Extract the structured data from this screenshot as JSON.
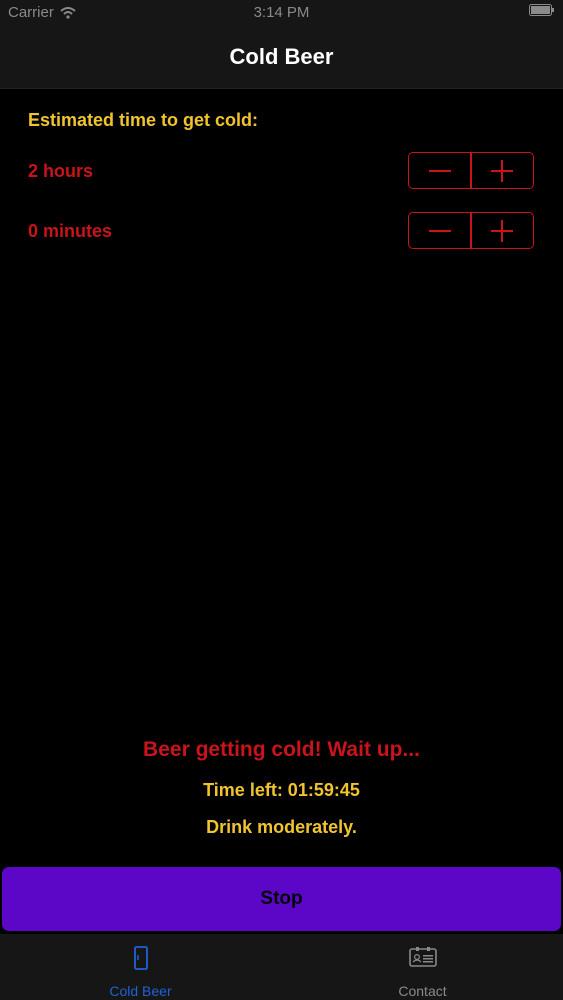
{
  "statusbar": {
    "carrier": "Carrier",
    "time": "3:14 PM"
  },
  "navbar": {
    "title": "Cold Beer"
  },
  "form": {
    "heading": "Estimated time to get cold:",
    "hours_label": "2 hours",
    "minutes_label": "0 minutes"
  },
  "status": {
    "message": "Beer getting cold! Wait up...",
    "time_left": "Time left: 01:59:45",
    "advice": "Drink moderately."
  },
  "actions": {
    "stop_label": "Stop"
  },
  "tabbar": {
    "tabs": [
      {
        "label": "Cold Beer",
        "icon": "fridge-icon",
        "selected": true
      },
      {
        "label": "Contact",
        "icon": "contact-card-icon",
        "selected": false
      }
    ]
  },
  "colors": {
    "accent_red": "#c8141a",
    "accent_yellow": "#f0c42e",
    "button_purple": "#5c07c7",
    "tab_selected": "#1e63d6",
    "tab_unselected": "#8a8a8a"
  }
}
